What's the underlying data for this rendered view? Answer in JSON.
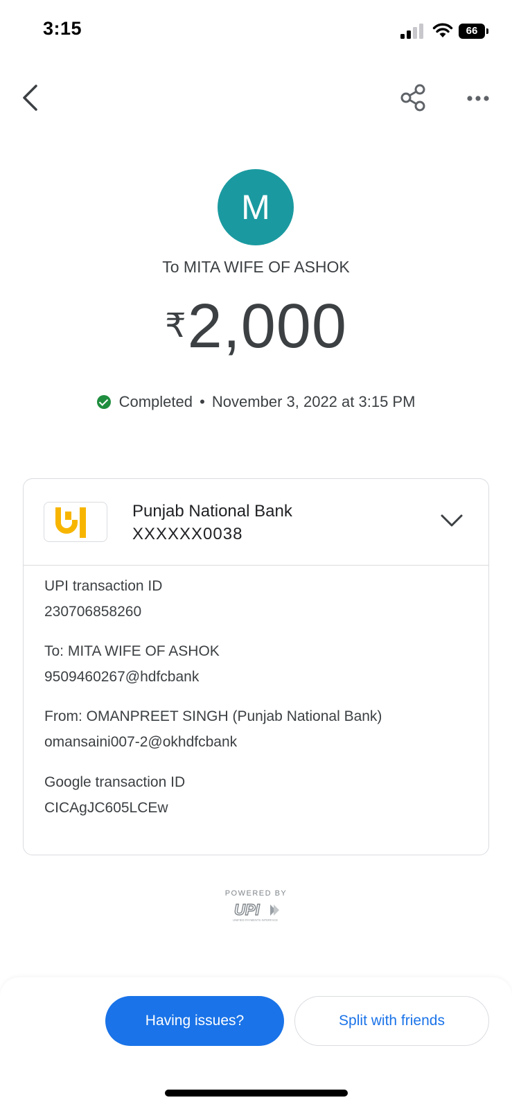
{
  "status_bar": {
    "time": "3:15",
    "battery": "66"
  },
  "top_bar": {
    "back_icon": "chevron-left-icon",
    "share_icon": "share-icon",
    "more_icon": "more-horizontal-icon"
  },
  "header": {
    "avatar_letter": "M",
    "avatar_color": "#1a9aa0",
    "recipient": "To MITA WIFE OF ASHOK",
    "currency_symbol": "₹",
    "amount": "2,000",
    "status": "Completed",
    "separator": "•",
    "datetime": "November 3, 2022 at 3:15 PM",
    "status_color": "#1e8e3e"
  },
  "bank": {
    "name": "Punjab National Bank",
    "account": "XXXXXX0038",
    "logo_color": "#f7b500"
  },
  "details": [
    {
      "label": "UPI transaction ID",
      "value": "230706858260"
    },
    {
      "label": "To: MITA WIFE OF ASHOK",
      "value": "9509460267@hdfcbank"
    },
    {
      "label": "From: OMANPREET SINGH (Punjab National Bank)",
      "value": "omansaini007-2@okhdfcbank"
    },
    {
      "label": "Google transaction ID",
      "value": "CICAgJC605LCEw"
    }
  ],
  "footer": {
    "powered_by": "POWERED BY",
    "upi_logo": "UPI",
    "upi_tagline": "UNIFIED PAYMENTS INTERFACE"
  },
  "actions": {
    "issues": "Having issues?",
    "split": "Split with friends",
    "primary_color": "#1a73e8"
  }
}
